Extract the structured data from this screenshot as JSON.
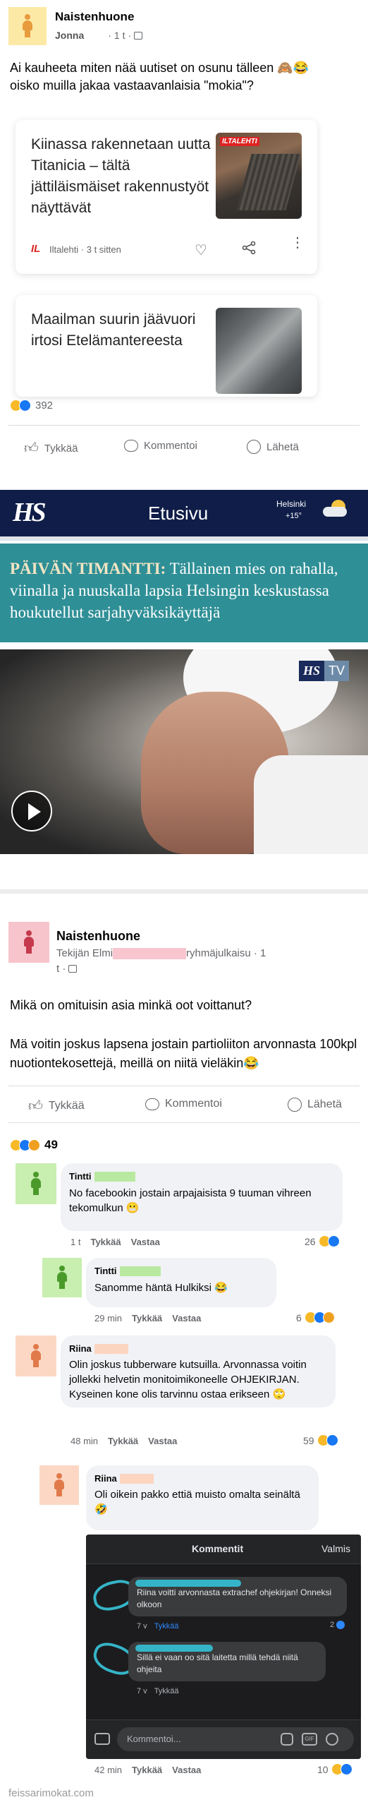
{
  "post1": {
    "group_name": "Naistenhuone",
    "author": "Jonna",
    "time": "1 t",
    "text": "Ai kauheeta miten nää uutiset on osunu tälleen 🙈😂 oisko muilla jakaa vastaavanlaisia \"mokia\"?",
    "card1": {
      "title": "Kiinassa rakennetaan uutta Titanicia – tältä jättiläismäiset rakennustyöt näyttävät",
      "source": "Iltalehti · 3 t sitten",
      "thumb_badge": "ILTALEHTI"
    },
    "card2": {
      "title": "Maailman suurin jäävuori irtosi Etelämantereesta"
    },
    "reaction_count": "392",
    "actions": {
      "like": "Tykkää",
      "comment": "Kommentoi",
      "send": "Lähetä"
    }
  },
  "hs": {
    "logo": "HS",
    "title": "Etusivu",
    "city": "Helsinki",
    "temp": "+15°",
    "headline_lead": "PÄIVÄN TIMANTTI:",
    "headline_rest": " Tällainen mies on rahalla, viinalla ja nuuskalla lapsia Helsingin keskustassa houkutellut sarjahyväksikäyttäjä",
    "tv_logo": "HS",
    "tv_label": "TV"
  },
  "post2": {
    "group_name": "Naistenhuone",
    "author_prefix": "Tekijän Elmi",
    "author_suffix": "ryhmäjulkaisu · 1",
    "time_line": "t ·",
    "question": "Mikä on omituisin asia minkä oot voittanut?",
    "answer": "Mä voitin joskus lapsena jostain partioliiton arvonnasta 100kpl nuotiontekosettejä, meillä on niitä vieläkin😂",
    "actions": {
      "like": "Tykkää",
      "comment": "Kommentoi",
      "send": "Lähetä"
    },
    "reaction_count": "49"
  },
  "comments": [
    {
      "name": "Tintti",
      "text": "No facebookin jostain arpajaisista 9 tuuman vihreen tekomulkun 😬",
      "time": "1 t",
      "like": "Tykkää",
      "reply": "Vastaa",
      "count": "26"
    },
    {
      "name": "Tintti",
      "text": "Sanomme häntä Hulkiksi 😂",
      "time": "29 min",
      "like": "Tykkää",
      "reply": "Vastaa",
      "count": "6"
    },
    {
      "name": "Riina",
      "text": "Olin joskus tubberware kutsuilla. Arvonnassa voitin jollekki helvetin monitoimikoneelle OHJEKIRJAN. Kyseinen kone olis tarvinnu ostaa erikseen 🙄",
      "time": "48 min",
      "like": "Tykkää",
      "reply": "Vastaa",
      "count": "59"
    },
    {
      "name": "Riina",
      "text": "Oli oikein pakko ettiä muisto omalta seinältä 🤣",
      "time": "42 min",
      "like": "Tykkää",
      "reply": "Vastaa",
      "count": "10"
    }
  ],
  "dark": {
    "title": "Kommentit",
    "done": "Valmis",
    "c1": "Riina voitti arvonnasta extrachef ohjekirjan! Onneksi olkoon",
    "c1_time": "7 v",
    "c1_like": "Tykkää",
    "c1_count": "2",
    "c2": "Sillä ei vaan oo sitä laitetta millä tehdä niitä ohjeita",
    "c2_time": "7 v",
    "c2_like": "Tykkää",
    "input_placeholder": "Kommentoi..."
  },
  "watermark": "feissarimokat.com"
}
